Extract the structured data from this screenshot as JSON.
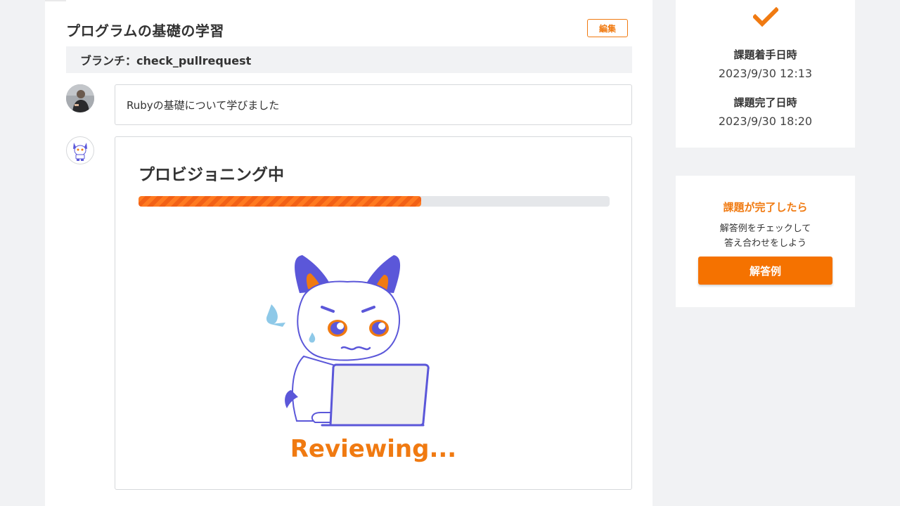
{
  "header": {
    "title": "プログラムの基礎の学習",
    "edit_label": "編集"
  },
  "branch": {
    "text": "ブランチ：check_pullrequest"
  },
  "comment": {
    "text": "Rubyの基礎について学びました"
  },
  "review": {
    "title": "プロビジョニング中",
    "progress_percent": 60,
    "status_text": "Reviewing..."
  },
  "sidebar": {
    "start_label": "課題着手日時",
    "start_value": "2023/9/30 12:13",
    "end_label": "課題完了日時",
    "end_value": "2023/9/30 18:20",
    "complete_title": "課題が完了したら",
    "complete_desc_line1": "解答例をチェックして",
    "complete_desc_line2": "答え合わせをしよう",
    "answer_button_label": "解答例"
  },
  "colors": {
    "accent": "#f07a11",
    "button": "#f57200",
    "mascot_purple": "#5b57d9",
    "background": "#f1f2f4"
  },
  "icons": {
    "check": "check-icon",
    "user_avatar": "user-avatar",
    "bot_avatar": "fox-mascot-avatar",
    "mascot": "fox-mascot-laptop"
  }
}
